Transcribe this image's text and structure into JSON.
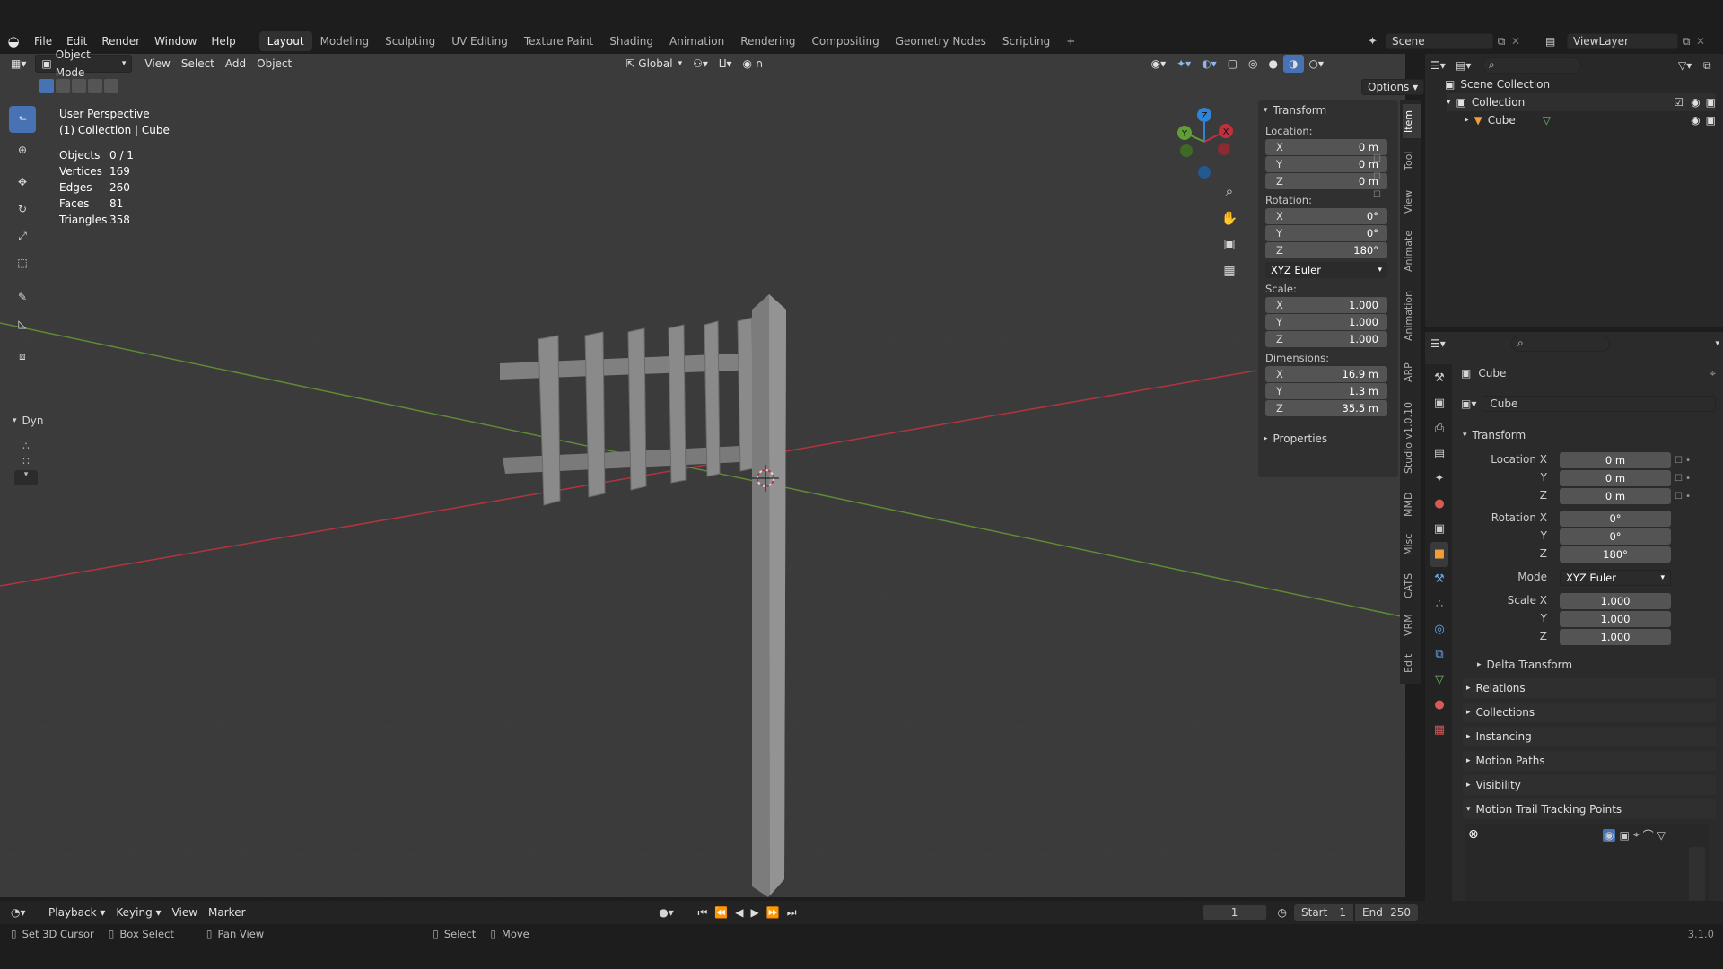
{
  "menu": {
    "items": [
      "File",
      "Edit",
      "Render",
      "Window",
      "Help"
    ]
  },
  "workspaces": {
    "tabs": [
      "Layout",
      "Modeling",
      "Sculpting",
      "UV Editing",
      "Texture Paint",
      "Shading",
      "Animation",
      "Rendering",
      "Compositing",
      "Geometry Nodes",
      "Scripting"
    ],
    "active": "Layout",
    "add_label": "+"
  },
  "scene": {
    "scene_name": "Scene",
    "view_layer": "ViewLayer"
  },
  "viewport_header": {
    "mode": "Object Mode",
    "menus": [
      "View",
      "Select",
      "Add",
      "Object"
    ],
    "orientation": "Global",
    "options_label": "Options"
  },
  "viewport_info": {
    "perspective": "User Perspective",
    "context": "(1) Collection | Cube",
    "stats": [
      {
        "label": "Objects",
        "value": "0 / 1"
      },
      {
        "label": "Vertices",
        "value": "169"
      },
      {
        "label": "Edges",
        "value": "260"
      },
      {
        "label": "Faces",
        "value": "81"
      },
      {
        "label": "Triangles",
        "value": "358"
      }
    ],
    "dyn_label": "Dyn"
  },
  "gizmo": {
    "x": "X",
    "y": "Y",
    "z": "Z"
  },
  "npanel": {
    "header": "Transform",
    "location_label": "Location:",
    "location": [
      {
        "axis": "X",
        "value": "0 m"
      },
      {
        "axis": "Y",
        "value": "0 m"
      },
      {
        "axis": "Z",
        "value": "0 m"
      }
    ],
    "rotation_label": "Rotation:",
    "rotation": [
      {
        "axis": "X",
        "value": "0°"
      },
      {
        "axis": "Y",
        "value": "0°"
      },
      {
        "axis": "Z",
        "value": "180°"
      }
    ],
    "rotation_mode": "XYZ Euler",
    "scale_label": "Scale:",
    "scale": [
      {
        "axis": "X",
        "value": "1.000"
      },
      {
        "axis": "Y",
        "value": "1.000"
      },
      {
        "axis": "Z",
        "value": "1.000"
      }
    ],
    "dimensions_label": "Dimensions:",
    "dimensions": [
      {
        "axis": "X",
        "value": "16.9 m"
      },
      {
        "axis": "Y",
        "value": "1.3 m"
      },
      {
        "axis": "Z",
        "value": "35.5 m"
      }
    ],
    "properties_label": "Properties"
  },
  "side_tabs": [
    "Item",
    "Tool",
    "View",
    "Animate",
    "Animation",
    "ARP",
    "Studio v1.0.10",
    "MMD",
    "Misc",
    "CATS",
    "VRM",
    "Edit"
  ],
  "outliner": {
    "scene_collection": "Scene Collection",
    "collection": "Collection",
    "object": "Cube"
  },
  "properties": {
    "object_name": "Cube",
    "data_name": "Cube",
    "transform_header": "Transform",
    "location_x_label": "Location X",
    "y_label": "Y",
    "z_label": "Z",
    "location": [
      "0 m",
      "0 m",
      "0 m"
    ],
    "rotation_x_label": "Rotation X",
    "rotation": [
      "0°",
      "0°",
      "180°"
    ],
    "mode_label": "Mode",
    "mode_value": "XYZ Euler",
    "scale_x_label": "Scale X",
    "scale": [
      "1.000",
      "1.000",
      "1.000"
    ],
    "sections": [
      "Delta Transform",
      "Relations",
      "Collections",
      "Instancing",
      "Motion Paths",
      "Visibility",
      "Motion Trail Tracking Points"
    ]
  },
  "timeline": {
    "menus": [
      "Playback",
      "Keying",
      "View",
      "Marker"
    ],
    "current_frame": "1",
    "start_label": "Start",
    "start_value": "1",
    "end_label": "End",
    "end_value": "250"
  },
  "statusbar": {
    "items": [
      "Set 3D Cursor",
      "Box Select",
      "Pan View",
      "Select",
      "Move"
    ],
    "version": "3.1.0"
  },
  "colors": {
    "accent": "#4772b3",
    "x_axis": "#c2303e",
    "y_axis": "#5f9f34",
    "z_axis": "#2f83d8"
  }
}
